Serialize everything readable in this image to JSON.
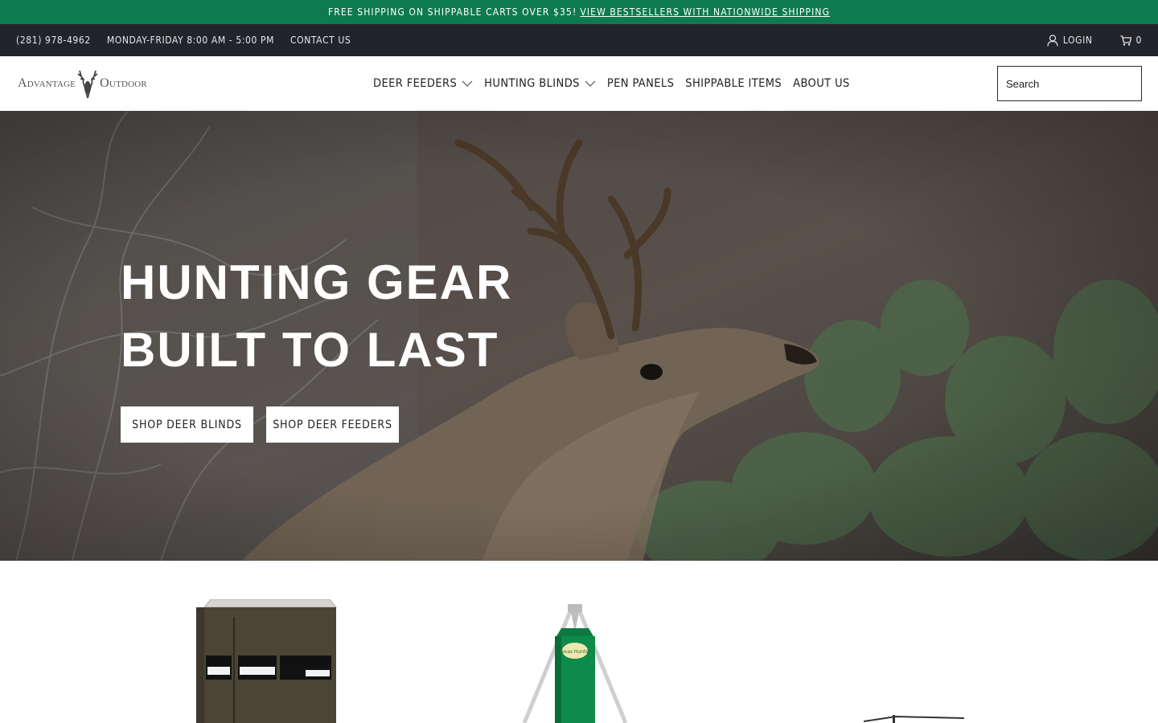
{
  "promo": {
    "text": "FREE SHIPPING ON SHIPPABLE CARTS OVER $35!",
    "link": "VIEW BESTSELLERS WITH NATIONWIDE SHIPPING"
  },
  "utility": {
    "phone": "(281) 978-4962",
    "hours": "MONDAY-FRIDAY 8:00 AM - 5:00 PM",
    "contact": "CONTACT US",
    "login": "LOGIN",
    "cart_count": "0"
  },
  "header": {
    "logo_left": "Advantage",
    "logo_right": "Outdoor",
    "nav": [
      {
        "label": "DEER FEEDERS"
      },
      {
        "label": "HUNTING BLINDS"
      },
      {
        "label": "PEN PANELS"
      },
      {
        "label": "SHIPPABLE ITEMS"
      },
      {
        "label": "ABOUT US"
      }
    ],
    "search_placeholder": "Search"
  },
  "hero": {
    "title_line1": "HUNTING GEAR",
    "title_line2": "BUILT TO LAST",
    "button_blinds": "SHOP DEER BLINDS",
    "button_feeders": "SHOP DEER FEEDERS"
  },
  "feeder_brand_mark": "Texas Hunter",
  "colors": {
    "promo_green": "#0e7a4e",
    "utility_dark": "#22242a",
    "blind_brown": "#4b4535",
    "feeder_green": "#0e8a4a"
  }
}
